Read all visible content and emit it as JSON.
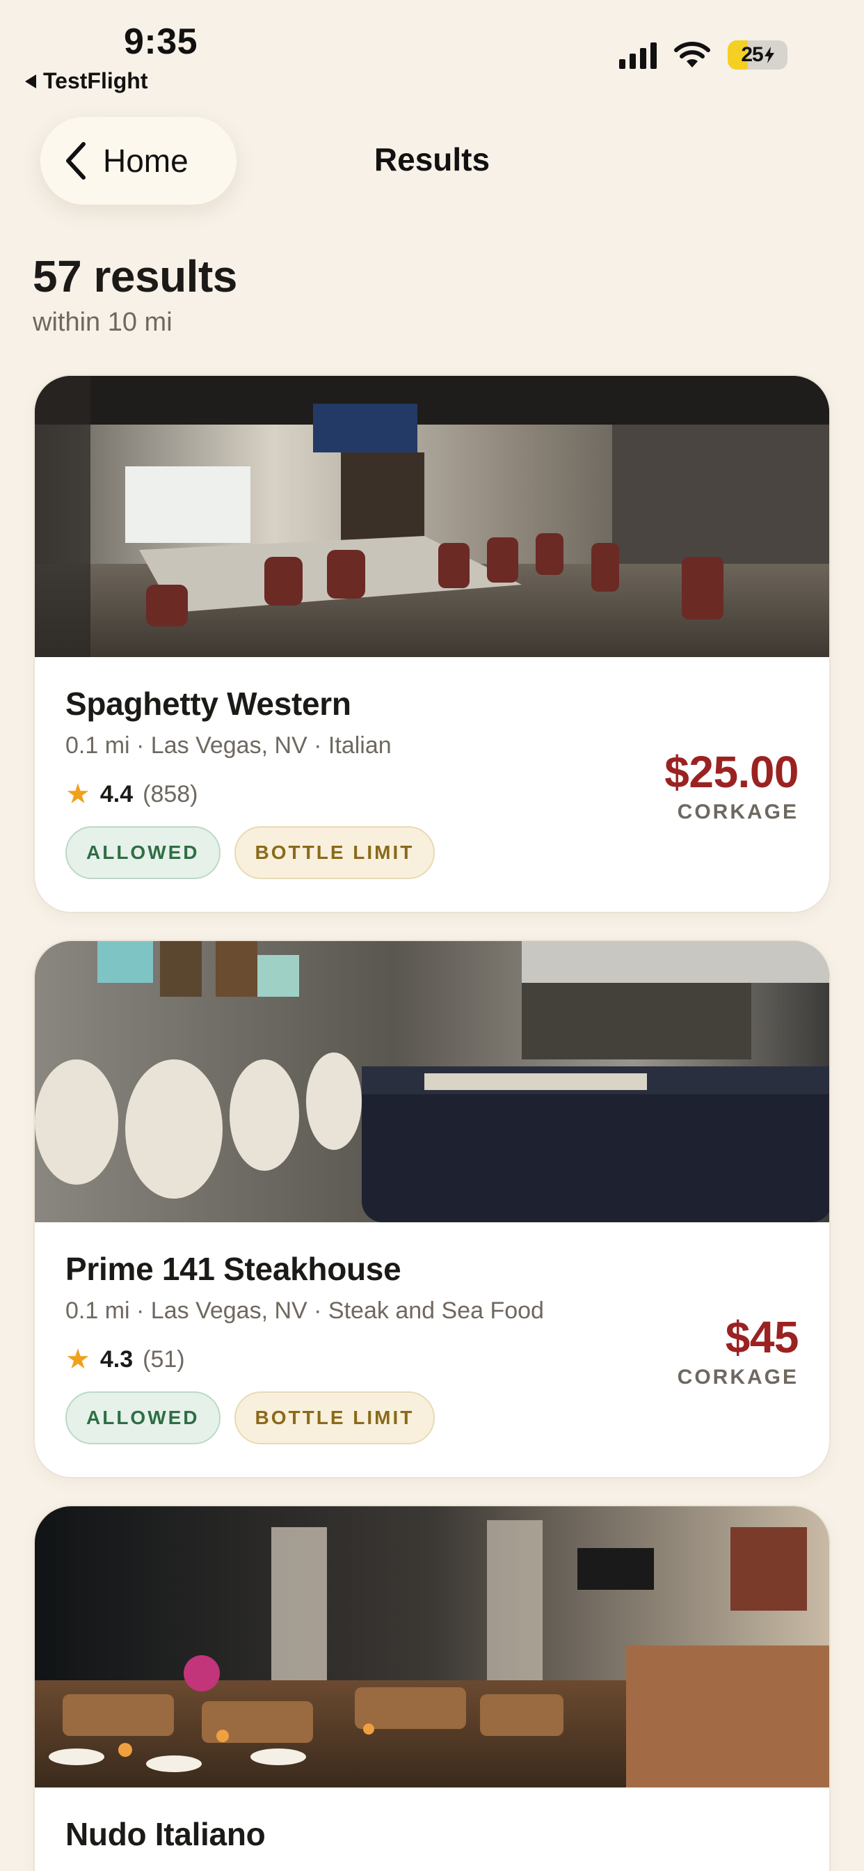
{
  "status_bar": {
    "time": "9:35",
    "back_app": "TestFlight",
    "battery_percent": "25",
    "icons": [
      "cellular-signal-icon",
      "wifi-icon",
      "battery-charging-icon"
    ]
  },
  "nav": {
    "back_label": "Home",
    "title": "Results"
  },
  "summary": {
    "count": "57 results",
    "radius": "within 10 mi"
  },
  "colors": {
    "background": "#f7f1e8",
    "price": "#9b2222",
    "star": "#f0a11c",
    "allowed": "#2e6e44",
    "bottle_limit": "#8a6a1a"
  },
  "results": [
    {
      "name": "Spaghetty Western",
      "meta": "0.1 mi · Las Vegas, NV · Italian",
      "rating": "4.4",
      "reviews": "(858)",
      "price": "$25.00",
      "price_label": "CORKAGE",
      "tags": [
        "ALLOWED",
        "BOTTLE LIMIT"
      ]
    },
    {
      "name": "Prime 141 Steakhouse",
      "meta": "0.1 mi · Las Vegas, NV · Steak and Sea Food",
      "rating": "4.3",
      "reviews": "(51)",
      "price": "$45",
      "price_label": "CORKAGE",
      "tags": [
        "ALLOWED",
        "BOTTLE LIMIT"
      ]
    },
    {
      "name": "Nudo Italiano"
    }
  ]
}
